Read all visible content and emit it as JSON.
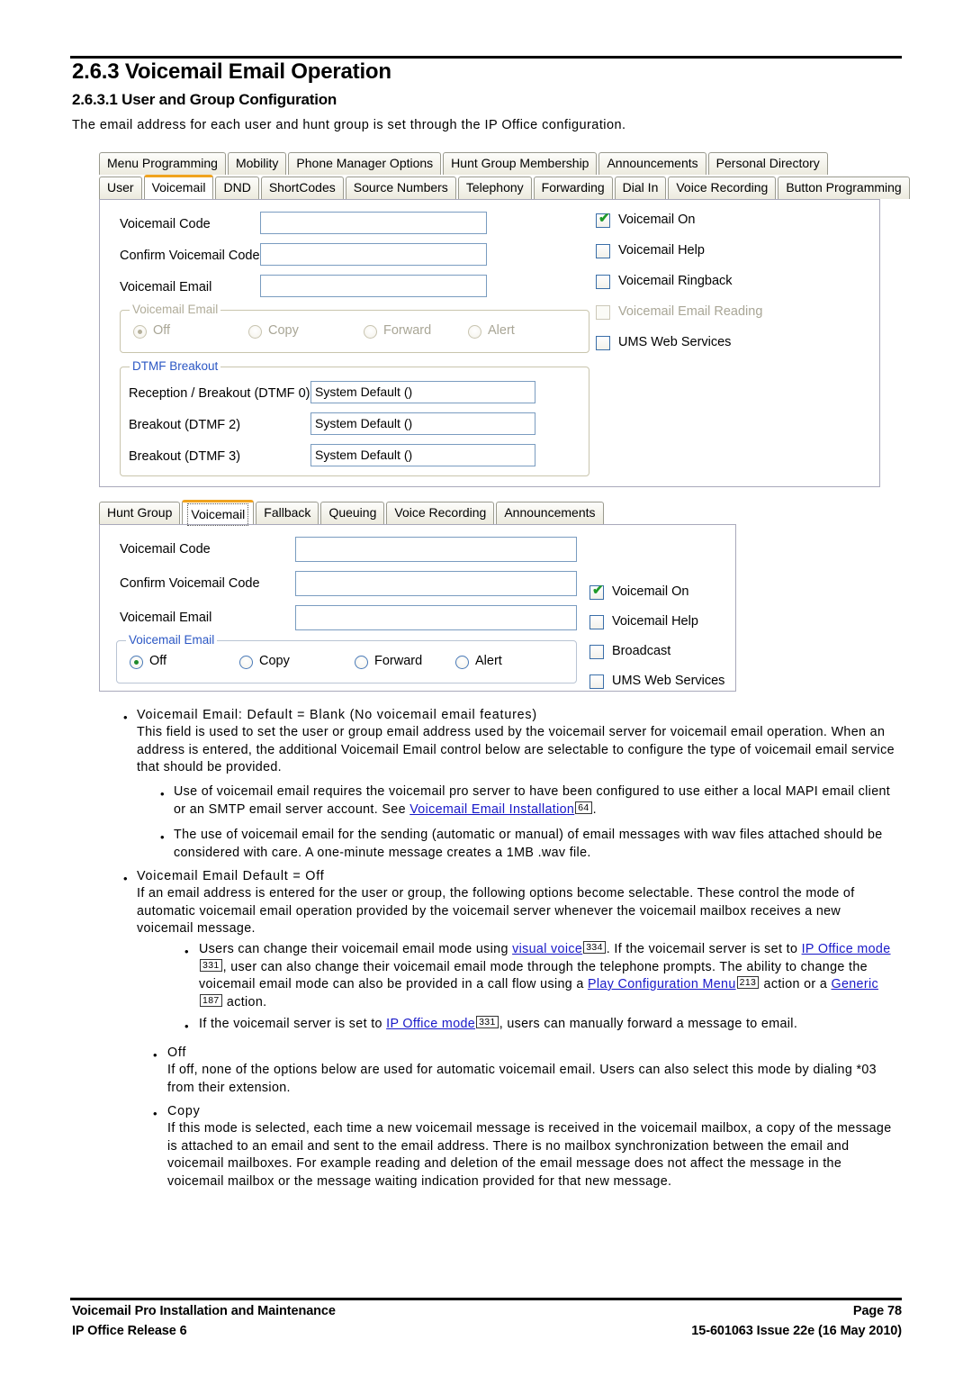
{
  "header": {
    "section_number_title": "2.6.3 Voicemail Email Operation",
    "subsection_title": "2.6.3.1 User and Group Configuration",
    "intro": "The email address for each user and hunt group is set through the IP Office configuration."
  },
  "user_dialog": {
    "tabs_row1": [
      "Menu Programming",
      "Mobility",
      "Phone Manager Options",
      "Hunt Group Membership",
      "Announcements",
      "Personal Directory"
    ],
    "tabs_row2": [
      "User",
      "Voicemail",
      "DND",
      "ShortCodes",
      "Source Numbers",
      "Telephony",
      "Forwarding",
      "Dial In",
      "Voice Recording",
      "Button Programming"
    ],
    "selected_tab": "Voicemail",
    "fields": [
      {
        "label": "Voicemail Code",
        "value": ""
      },
      {
        "label": "Confirm Voicemail Code",
        "value": ""
      },
      {
        "label": "Voicemail Email",
        "value": ""
      }
    ],
    "email_group": {
      "title": "Voicemail Email",
      "enabled": false,
      "options": [
        "Off",
        "Copy",
        "Forward",
        "Alert"
      ],
      "selected": "Off"
    },
    "dtmf_group": {
      "title": "DTMF Breakout",
      "rows": [
        {
          "label": "Reception / Breakout (DTMF 0)",
          "value": "System Default ()"
        },
        {
          "label": "Breakout (DTMF 2)",
          "value": "System Default ()"
        },
        {
          "label": "Breakout (DTMF 3)",
          "value": "System Default ()"
        }
      ]
    },
    "checkboxes": [
      {
        "label": "Voicemail On",
        "checked": true,
        "enabled": true
      },
      {
        "label": "Voicemail Help",
        "checked": false,
        "enabled": true
      },
      {
        "label": "Voicemail Ringback",
        "checked": false,
        "enabled": true
      },
      {
        "label": "Voicemail Email Reading",
        "checked": false,
        "enabled": false
      },
      {
        "label": "UMS Web Services",
        "checked": false,
        "enabled": true
      }
    ]
  },
  "group_dialog": {
    "tabs": [
      "Hunt Group",
      "Voicemail",
      "Fallback",
      "Queuing",
      "Voice Recording",
      "Announcements"
    ],
    "selected_tab": "Voicemail",
    "fields": [
      {
        "label": "Voicemail Code",
        "value": ""
      },
      {
        "label": "Confirm Voicemail Code",
        "value": ""
      },
      {
        "label": "Voicemail Email",
        "value": ""
      }
    ],
    "email_group": {
      "title": "Voicemail Email",
      "enabled": true,
      "options": [
        "Off",
        "Copy",
        "Forward",
        "Alert"
      ],
      "selected": "Off"
    },
    "checkboxes": [
      {
        "label": "Voicemail On",
        "checked": true,
        "enabled": true
      },
      {
        "label": "Voicemail Help",
        "checked": false,
        "enabled": true
      },
      {
        "label": "Broadcast",
        "checked": false,
        "enabled": true
      },
      {
        "label": "UMS Web Services",
        "checked": false,
        "enabled": true
      }
    ]
  },
  "body": {
    "b1_head": "Voicemail Email: Default = Blank (No voicemail email features)",
    "b1_text": "This field is used to set the user or group email address used by the voicemail server for voicemail email operation. When an address is entered, the additional Voicemail Email control below are selectable to configure the type of voicemail email service that should be provided.",
    "b1_sub1_pre": "Use of voicemail email requires the voicemail pro server to have been configured to use either a local MAPI email client or an SMTP email server account. See ",
    "b1_sub1_link": "Voicemail Email Installation",
    "b1_sub1_pageref": "64",
    "b1_sub1_post": ".",
    "b1_sub2": "The use of voicemail email for the sending (automatic or manual) of email messages with wav files attached should be considered with care. A one-minute message creates a 1MB .wav file.",
    "b2_head": "Voicemail Email Default = Off",
    "b2_text": "If an email address is entered for the user or group, the following options become selectable. These control the mode of automatic voicemail email operation provided by the voicemail server whenever the voicemail mailbox receives a new voicemail message.",
    "b2_sub1_p1": "Users can change their voicemail email mode using ",
    "b2_sub1_link1": "visual voice",
    "b2_sub1_ref1": "334",
    "b2_sub1_p2": ". If the voicemail server is set to ",
    "b2_sub1_link2": "IP Office mode",
    "b2_sub1_ref2": "331",
    "b2_sub1_p3": ", user can also change their voicemail email mode through the telephone prompts. The ability to change the voicemail email mode can also be provided in a call flow using a ",
    "b2_sub1_link3": "Play Configuration Menu",
    "b2_sub1_ref3": "213",
    "b2_sub1_p4": " action or a ",
    "b2_sub1_link4": "Generic",
    "b2_sub1_ref4": "187",
    "b2_sub1_p5": " action.",
    "b2_sub2_p1": "If the voicemail server is set to ",
    "b2_sub2_link": "IP Office mode",
    "b2_sub2_ref": "331",
    "b2_sub2_p2": ", users can manually forward a message to email.",
    "b3_head": "Off",
    "b3_text": "If off, none of the options below are used for automatic voicemail email. Users can also select this mode by dialing *03 from their extension.",
    "b4_head": "Copy",
    "b4_text": "If this mode is selected, each time a new voicemail message is received in the voicemail mailbox, a copy of the message is attached to an email and sent to the email address. There is no mailbox synchronization between the email and voicemail mailboxes. For example reading and deletion of the email message does not affect the message in the voicemail mailbox or the message waiting indication provided for that new message."
  },
  "footer": {
    "left_line1": "Voicemail Pro Installation and Maintenance",
    "left_line2": "IP Office Release 6",
    "right_line1": "Page 78",
    "right_line2": "15-601063 Issue 22e (16 May 2010)"
  }
}
